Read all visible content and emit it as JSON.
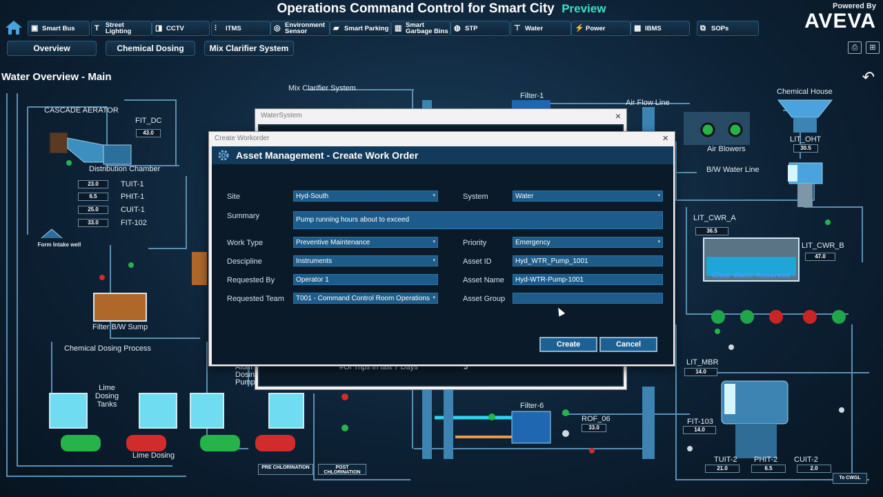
{
  "header": {
    "title": "Operations Command Control for Smart City",
    "preview": "Preview",
    "powered_by": "Powered By",
    "brand": "AVEVA"
  },
  "nav": {
    "items": [
      {
        "label": "Smart Bus",
        "icon": "bus-icon"
      },
      {
        "label": "Street Lighting",
        "icon": "street-light-icon"
      },
      {
        "label": "CCTV",
        "icon": "camera-icon"
      },
      {
        "label": "ITMS",
        "icon": "traffic-icon"
      },
      {
        "label": "Environment Sensor",
        "icon": "sensor-icon"
      },
      {
        "label": "Smart Parking",
        "icon": "car-icon"
      },
      {
        "label": "Smart Garbage Bins",
        "icon": "bin-icon"
      },
      {
        "label": "STP",
        "icon": "stp-icon"
      },
      {
        "label": "Water",
        "icon": "water-tap-icon"
      },
      {
        "label": "Power",
        "icon": "power-icon"
      },
      {
        "label": "IBMS",
        "icon": "building-icon"
      },
      {
        "label": "SOPs",
        "icon": "sop-icon"
      }
    ]
  },
  "subtabs": [
    "Overview",
    "Chemical Dosing",
    "Mix Clarifier System"
  ],
  "section_title": "Water Overview - Main",
  "schematic": {
    "cascade_aerator": "CASCADE AERATOR",
    "fit_dc": "FIT_DC",
    "fit_dc_value": "43.0",
    "distribution_chamber": "Distribution Chamber",
    "tuit1": "TUIT-1",
    "tuit1_value": "23.0",
    "phit1": "PHIT-1",
    "phit1_value": "6.5",
    "cuit1": "CUIT-1",
    "cuit1_value": "25.0",
    "fit102": "FIT-102",
    "fit102_value": "33.0",
    "form_intake": "Form Intake well",
    "filter_bw_sump": "Filter B/W Sump",
    "chemical_dosing_process": "Chemical Dosing Process",
    "lime_dosing_tanks": "Lime Dosing Tanks",
    "lime_dosing": "Lime Dosing",
    "alum_dosing_pump": "Alum Dosing Pump",
    "pre_chlorination": "PRE CHLORINATION",
    "post_chlorination": "POST CHLORINATION",
    "mix_clarifier": "Mix Clarifier System",
    "filter1": "Filter-1",
    "filter6": "Filter-6",
    "rof06": "ROF_06",
    "rof06_value": "33.0",
    "air_flow_line": "Air Flow Line",
    "air_blowers": "Air Blowers",
    "bw_water_line": "B/W Water Line",
    "chemical_house": "Chemical House",
    "lit_oht": "LIT_OHT",
    "lit_oht_value": "30.5",
    "lit_cwr_a": "LIT_CWR_A",
    "lit_cwr_a_value": "36.5",
    "lit_cwr_b": "LIT_CWR_B",
    "lit_cwr_b_value": "47.0",
    "clear_water_reservoir": "Clear Water Reservoir",
    "lit_mbr": "LIT_MBR",
    "lit_mbr_value": "14.0",
    "fit103": "FIT-103",
    "fit103_value": "14.0",
    "tuit2": "TUIT-2",
    "tuit2_value": "21.0",
    "phit2": "PHIT-2",
    "phit2_value": "6.5",
    "cuit2": "CUIT-2",
    "cuit2_value": "2.0",
    "to_cwgl": "To CWGL"
  },
  "water_system_window": {
    "title": "WaterSystem",
    "trips_label": "#Of Trips in last 7 Days",
    "trips_value": "5"
  },
  "dialog": {
    "window_title": "Create Workorder",
    "heading": "Asset Management - Create Work Order",
    "fields": {
      "site_label": "Site",
      "site_value": "Hyd-South",
      "system_label": "System",
      "system_value": "Water",
      "summary_label": "Summary",
      "summary_value": "Pump running hours about to exceed",
      "work_type_label": "Work Type",
      "work_type_value": "Preventive Maintenance",
      "priority_label": "Priority",
      "priority_value": "Emergency",
      "descipline_label": "Descipline",
      "descipline_value": "Instruments",
      "asset_id_label": "Asset ID",
      "asset_id_value": "Hyd_WTR_Pump_1001",
      "requested_by_label": "Requested By",
      "requested_by_value": "Operator 1",
      "asset_name_label": "Asset Name",
      "asset_name_value": "Hyd-WTR-Pump-1001",
      "requested_team_label": "Requested Team",
      "requested_team_value": "T001 - Command Control Room Operations",
      "asset_group_label": "Asset Group",
      "asset_group_value": ""
    },
    "create_label": "Create",
    "cancel_label": "Cancel"
  },
  "colors": {
    "accent": "#3fe0c2",
    "field_bg": "#1d5c8a",
    "dialog_header": "#123a5a",
    "pipe": "#5b8fb3"
  }
}
